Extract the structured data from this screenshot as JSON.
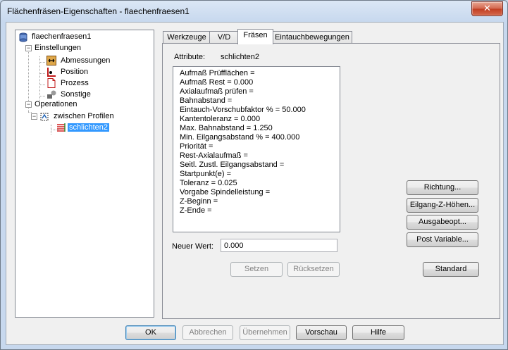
{
  "window": {
    "title": "Flächenfräsen-Eigenschaften - flaechenfraesen1",
    "close_glyph": "✕"
  },
  "tree": {
    "root": "flaechenfraesen1",
    "settings": "Einstellungen",
    "settings_children": [
      "Abmessungen",
      "Position",
      "Prozess",
      "Sonstige"
    ],
    "operations": "Operationen",
    "group": "zwischen Profilen",
    "selected": "schlichten2",
    "expand_glyph": "−"
  },
  "tabs": [
    "Werkzeuge",
    "V/D",
    "Fräsen",
    "Eintauchbewegungen"
  ],
  "active_tab": 2,
  "panel": {
    "attr_label": "Attribute:",
    "attr_value": "schlichten2",
    "attributes": [
      "Aufmaß Prüfflächen =",
      "Aufmaß Rest = 0.000",
      "Axialaufmaß prüfen =",
      "Bahnabstand =",
      "Eintauch-Vorschubfaktor % = 50.000",
      "Kantentoleranz = 0.000",
      "Max. Bahnabstand = 1.250",
      "Min. Eilgangsabstand % = 400.000",
      "Priorität =",
      "Rest-Axialaufmaß =",
      "Seitl. Zustl. Eilgangsabstand =",
      "Startpunkt(e) =",
      "Toleranz = 0.025",
      "Vorgabe Spindelleistung =",
      "Z-Beginn =",
      "Z-Ende ="
    ],
    "new_value_label": "Neuer Wert:",
    "new_value": "0.000",
    "set_button": "Setzen",
    "reset_button": "Rücksetzen",
    "right_buttons": [
      "Richtung...",
      "Eilgang-Z-Höhen...",
      "Ausgabeopt...",
      "Post Variable..."
    ],
    "standard_button": "Standard"
  },
  "footer": {
    "ok": "OK",
    "cancel": "Abbrechen",
    "apply": "Übernehmen",
    "preview": "Vorschau",
    "help": "Hilfe"
  }
}
